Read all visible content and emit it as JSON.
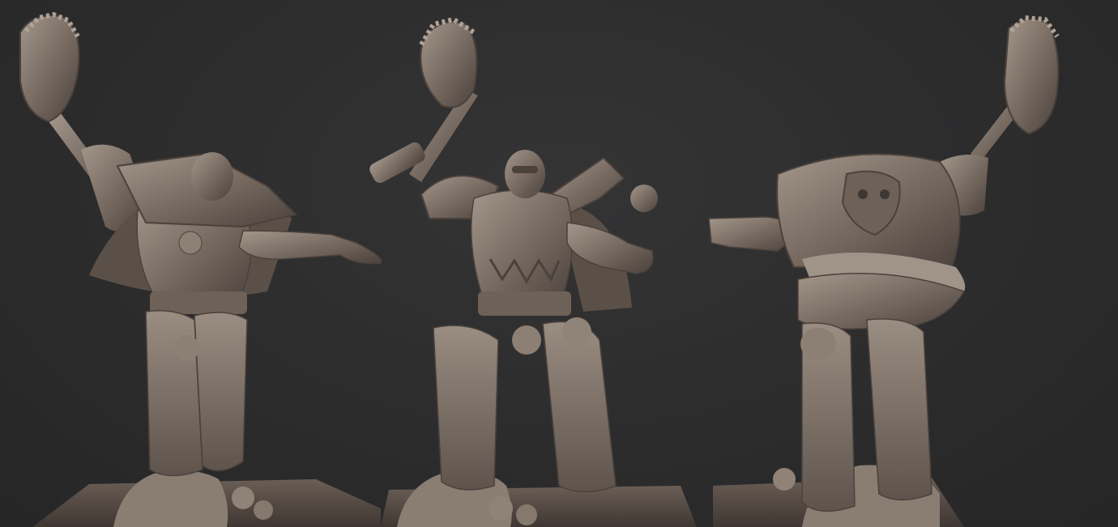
{
  "scene": {
    "background_color": "#2c2c2d",
    "model_color": "#7d7066",
    "model_highlight_color": "#a3968b",
    "model_shadow_color": "#4b423c",
    "base_color": "#5a4f47"
  },
  "views": [
    {
      "name": "three-quarter-left",
      "pose": "pointing"
    },
    {
      "name": "front",
      "pose": "pointing"
    },
    {
      "name": "rear",
      "pose": "arm-extended"
    }
  ]
}
